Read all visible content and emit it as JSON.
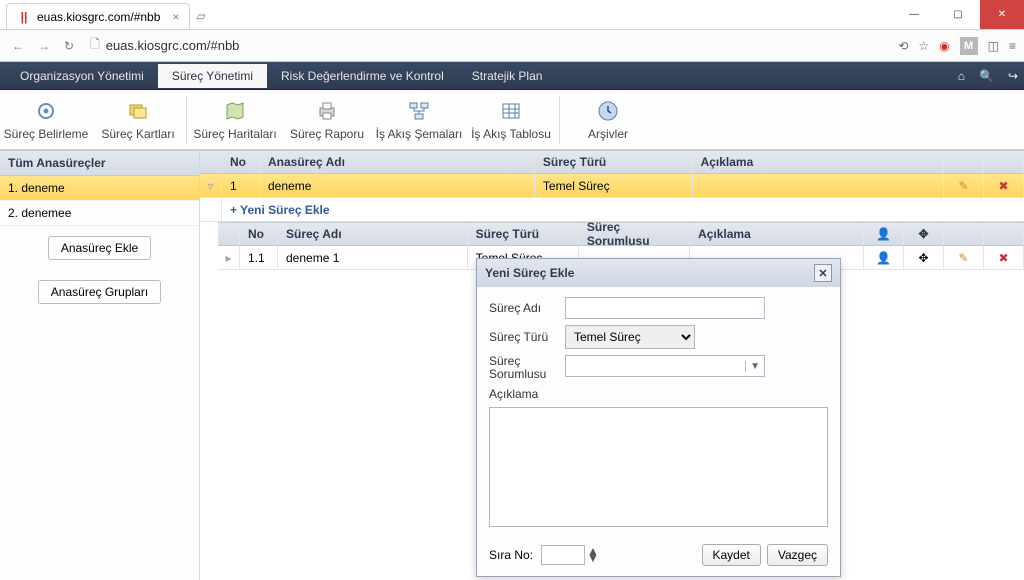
{
  "browser": {
    "tab_title": "euas.kiosgrc.com/#nbb",
    "url": "euas.kiosgrc.com/#nbb"
  },
  "menubar": {
    "items": [
      "Organizasyon Yönetimi",
      "Süreç Yönetimi",
      "Risk Değerlendirme ve Kontrol",
      "Stratejik Plan"
    ],
    "active_index": 1
  },
  "toolbar": {
    "items": [
      {
        "label": "Süreç Belirleme"
      },
      {
        "label": "Süreç Kartları"
      },
      {
        "label": "Süreç Haritaları"
      },
      {
        "label": "Süreç Raporu"
      },
      {
        "label": "İş Akış Şemaları"
      },
      {
        "label": "İş Akış Tablosu"
      },
      {
        "label": "Arşivler"
      }
    ]
  },
  "sidebar": {
    "header": "Tüm Anasüreçler",
    "items": [
      {
        "label": "1. deneme",
        "selected": true
      },
      {
        "label": "2. denemee",
        "selected": false
      }
    ],
    "btn_add": "Anasüreç Ekle",
    "btn_groups": "Anasüreç Grupları"
  },
  "grid": {
    "top_headers": {
      "no": "No",
      "name": "Anasüreç Adı",
      "type": "Süreç Türü",
      "desc": "Açıklama"
    },
    "top_row": {
      "no": "1",
      "name": "deneme",
      "type": "Temel Süreç",
      "desc": ""
    },
    "add_label": "+ Yeni Süreç Ekle",
    "sub_headers": {
      "no": "No",
      "name": "Süreç Adı",
      "type": "Süreç Türü",
      "resp": "Süreç Sorumlusu",
      "desc": "Açıklama"
    },
    "sub_row": {
      "no": "1.1",
      "name": "deneme 1",
      "type": "Temel Süreç",
      "resp": "",
      "desc": ""
    }
  },
  "dialog": {
    "title": "Yeni Süreç Ekle",
    "lbl_name": "Süreç Adı",
    "lbl_type": "Süreç Türü",
    "type_value": "Temel Süreç",
    "lbl_resp": "Süreç Sorumlusu",
    "lbl_desc": "Açıklama",
    "lbl_order": "Sıra No:",
    "btn_save": "Kaydet",
    "btn_cancel": "Vazgeç"
  }
}
